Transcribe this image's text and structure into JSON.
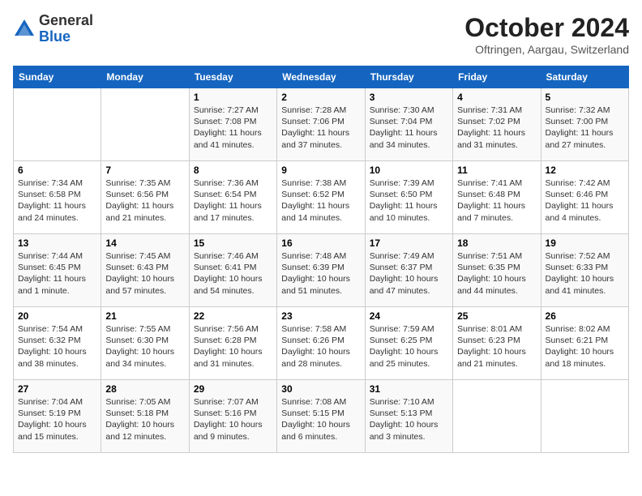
{
  "header": {
    "logo_general": "General",
    "logo_blue": "Blue",
    "month": "October 2024",
    "location": "Oftringen, Aargau, Switzerland"
  },
  "weekdays": [
    "Sunday",
    "Monday",
    "Tuesday",
    "Wednesday",
    "Thursday",
    "Friday",
    "Saturday"
  ],
  "weeks": [
    [
      {
        "day": "",
        "content": ""
      },
      {
        "day": "",
        "content": ""
      },
      {
        "day": "1",
        "content": "Sunrise: 7:27 AM\nSunset: 7:08 PM\nDaylight: 11 hours and 41 minutes."
      },
      {
        "day": "2",
        "content": "Sunrise: 7:28 AM\nSunset: 7:06 PM\nDaylight: 11 hours and 37 minutes."
      },
      {
        "day": "3",
        "content": "Sunrise: 7:30 AM\nSunset: 7:04 PM\nDaylight: 11 hours and 34 minutes."
      },
      {
        "day": "4",
        "content": "Sunrise: 7:31 AM\nSunset: 7:02 PM\nDaylight: 11 hours and 31 minutes."
      },
      {
        "day": "5",
        "content": "Sunrise: 7:32 AM\nSunset: 7:00 PM\nDaylight: 11 hours and 27 minutes."
      }
    ],
    [
      {
        "day": "6",
        "content": "Sunrise: 7:34 AM\nSunset: 6:58 PM\nDaylight: 11 hours and 24 minutes."
      },
      {
        "day": "7",
        "content": "Sunrise: 7:35 AM\nSunset: 6:56 PM\nDaylight: 11 hours and 21 minutes."
      },
      {
        "day": "8",
        "content": "Sunrise: 7:36 AM\nSunset: 6:54 PM\nDaylight: 11 hours and 17 minutes."
      },
      {
        "day": "9",
        "content": "Sunrise: 7:38 AM\nSunset: 6:52 PM\nDaylight: 11 hours and 14 minutes."
      },
      {
        "day": "10",
        "content": "Sunrise: 7:39 AM\nSunset: 6:50 PM\nDaylight: 11 hours and 10 minutes."
      },
      {
        "day": "11",
        "content": "Sunrise: 7:41 AM\nSunset: 6:48 PM\nDaylight: 11 hours and 7 minutes."
      },
      {
        "day": "12",
        "content": "Sunrise: 7:42 AM\nSunset: 6:46 PM\nDaylight: 11 hours and 4 minutes."
      }
    ],
    [
      {
        "day": "13",
        "content": "Sunrise: 7:44 AM\nSunset: 6:45 PM\nDaylight: 11 hours and 1 minute."
      },
      {
        "day": "14",
        "content": "Sunrise: 7:45 AM\nSunset: 6:43 PM\nDaylight: 10 hours and 57 minutes."
      },
      {
        "day": "15",
        "content": "Sunrise: 7:46 AM\nSunset: 6:41 PM\nDaylight: 10 hours and 54 minutes."
      },
      {
        "day": "16",
        "content": "Sunrise: 7:48 AM\nSunset: 6:39 PM\nDaylight: 10 hours and 51 minutes."
      },
      {
        "day": "17",
        "content": "Sunrise: 7:49 AM\nSunset: 6:37 PM\nDaylight: 10 hours and 47 minutes."
      },
      {
        "day": "18",
        "content": "Sunrise: 7:51 AM\nSunset: 6:35 PM\nDaylight: 10 hours and 44 minutes."
      },
      {
        "day": "19",
        "content": "Sunrise: 7:52 AM\nSunset: 6:33 PM\nDaylight: 10 hours and 41 minutes."
      }
    ],
    [
      {
        "day": "20",
        "content": "Sunrise: 7:54 AM\nSunset: 6:32 PM\nDaylight: 10 hours and 38 minutes."
      },
      {
        "day": "21",
        "content": "Sunrise: 7:55 AM\nSunset: 6:30 PM\nDaylight: 10 hours and 34 minutes."
      },
      {
        "day": "22",
        "content": "Sunrise: 7:56 AM\nSunset: 6:28 PM\nDaylight: 10 hours and 31 minutes."
      },
      {
        "day": "23",
        "content": "Sunrise: 7:58 AM\nSunset: 6:26 PM\nDaylight: 10 hours and 28 minutes."
      },
      {
        "day": "24",
        "content": "Sunrise: 7:59 AM\nSunset: 6:25 PM\nDaylight: 10 hours and 25 minutes."
      },
      {
        "day": "25",
        "content": "Sunrise: 8:01 AM\nSunset: 6:23 PM\nDaylight: 10 hours and 21 minutes."
      },
      {
        "day": "26",
        "content": "Sunrise: 8:02 AM\nSunset: 6:21 PM\nDaylight: 10 hours and 18 minutes."
      }
    ],
    [
      {
        "day": "27",
        "content": "Sunrise: 7:04 AM\nSunset: 5:19 PM\nDaylight: 10 hours and 15 minutes."
      },
      {
        "day": "28",
        "content": "Sunrise: 7:05 AM\nSunset: 5:18 PM\nDaylight: 10 hours and 12 minutes."
      },
      {
        "day": "29",
        "content": "Sunrise: 7:07 AM\nSunset: 5:16 PM\nDaylight: 10 hours and 9 minutes."
      },
      {
        "day": "30",
        "content": "Sunrise: 7:08 AM\nSunset: 5:15 PM\nDaylight: 10 hours and 6 minutes."
      },
      {
        "day": "31",
        "content": "Sunrise: 7:10 AM\nSunset: 5:13 PM\nDaylight: 10 hours and 3 minutes."
      },
      {
        "day": "",
        "content": ""
      },
      {
        "day": "",
        "content": ""
      }
    ]
  ]
}
